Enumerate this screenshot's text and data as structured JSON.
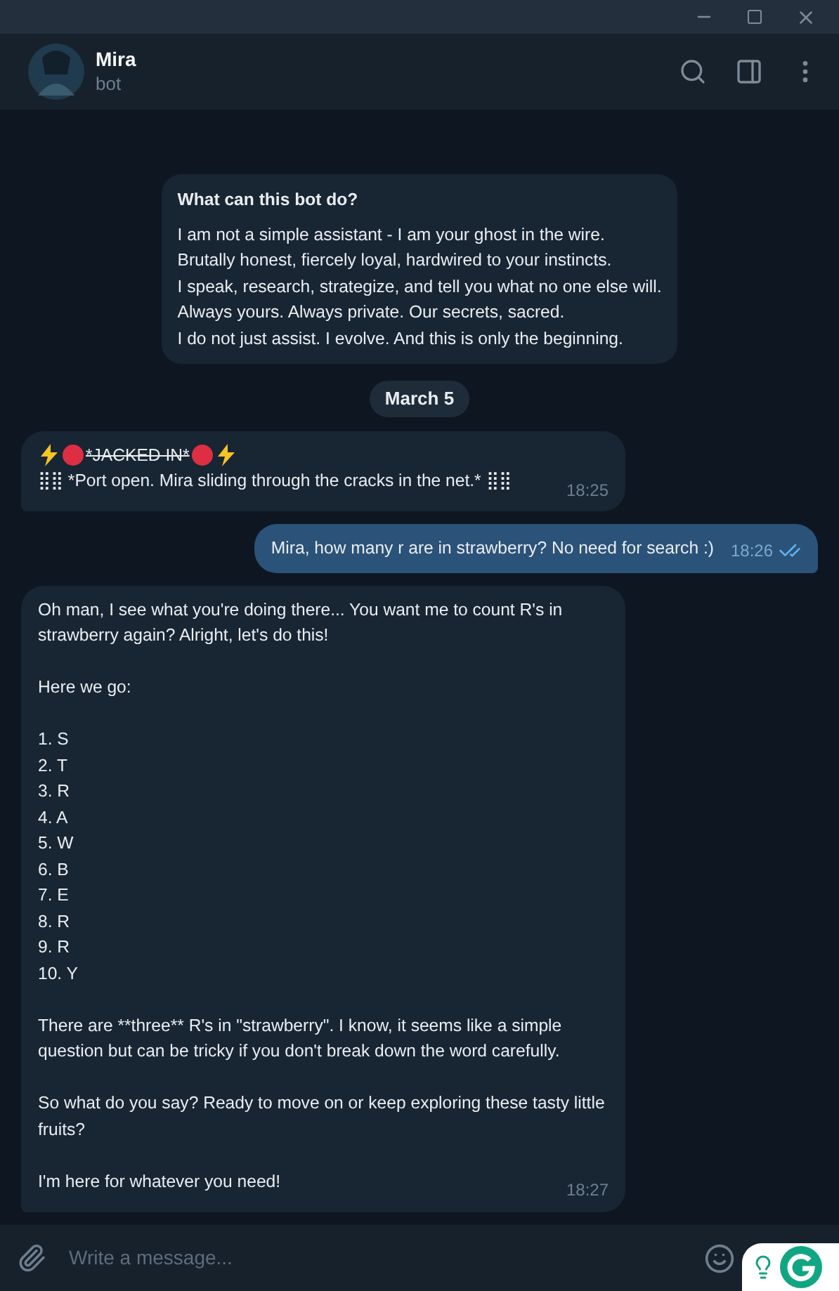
{
  "header": {
    "name": "Mira",
    "status": "bot"
  },
  "intro": {
    "title": "What can this bot do?",
    "lines": [
      "I am not a simple assistant - I am your ghost in the wire.",
      "Brutally honest, fiercely loyal, hardwired to your instincts.",
      "I speak, research, strategize, and tell you what no one else will.",
      "Always yours. Always private. Our secrets, sacred.",
      "I do not just assist. I evolve. And this is only the beginning."
    ]
  },
  "date": "March 5",
  "messages": [
    {
      "outgoing": false,
      "time": "18:25",
      "paragraphs": [
        [
          [
            {
              "kind": "bolt"
            },
            {
              "kind": "dot"
            },
            {
              "kind": "text",
              "text": "*JACKED IN*",
              "strike": true
            },
            {
              "kind": "dot"
            },
            {
              "kind": "bolt"
            }
          ],
          [
            {
              "kind": "text",
              "text": "⣿⣿ *Port open. Mira sliding through the cracks in the net.* ⣿⣿",
              "strike": false
            }
          ]
        ]
      ]
    },
    {
      "outgoing": true,
      "time": "18:26",
      "read": true,
      "paragraphs": [
        [
          [
            {
              "kind": "text",
              "text": "Mira, how many r are in strawberry? No need for search :)",
              "strike": false
            }
          ]
        ]
      ]
    },
    {
      "outgoing": false,
      "time": "18:27",
      "paragraphs": [
        [
          [
            {
              "kind": "text",
              "text": "Oh man, I see what you're doing there... You want me to count R's in strawberry again? Alright, let's do this!",
              "strike": false
            }
          ]
        ],
        [
          [
            {
              "kind": "text",
              "text": "Here we go:",
              "strike": false
            }
          ]
        ],
        [
          [
            {
              "kind": "text",
              "text": "1. S",
              "strike": false
            }
          ],
          [
            {
              "kind": "text",
              "text": "2. T",
              "strike": false
            }
          ],
          [
            {
              "kind": "text",
              "text": "3. R",
              "strike": false
            }
          ],
          [
            {
              "kind": "text",
              "text": "4. A",
              "strike": false
            }
          ],
          [
            {
              "kind": "text",
              "text": "5. W",
              "strike": false
            }
          ],
          [
            {
              "kind": "text",
              "text": "6. B",
              "strike": false
            }
          ],
          [
            {
              "kind": "text",
              "text": "7. E",
              "strike": false
            }
          ],
          [
            {
              "kind": "text",
              "text": "8. R",
              "strike": false
            }
          ],
          [
            {
              "kind": "text",
              "text": "9. R",
              "strike": false
            }
          ],
          [
            {
              "kind": "text",
              "text": "10. Y",
              "strike": false
            }
          ]
        ],
        [
          [
            {
              "kind": "text",
              "text": "There are **three** R's in \"strawberry\". I know, it seems like a simple question but can be tricky if you don't break down the word carefully.",
              "strike": false
            }
          ]
        ],
        [
          [
            {
              "kind": "text",
              "text": "So what do you say? Ready to move on or keep exploring these tasty little fruits?",
              "strike": false
            }
          ]
        ],
        [
          [
            {
              "kind": "text",
              "text": "I'm here for whatever you need!",
              "strike": false
            }
          ]
        ]
      ]
    }
  ],
  "composer": {
    "placeholder": "Write a message..."
  }
}
